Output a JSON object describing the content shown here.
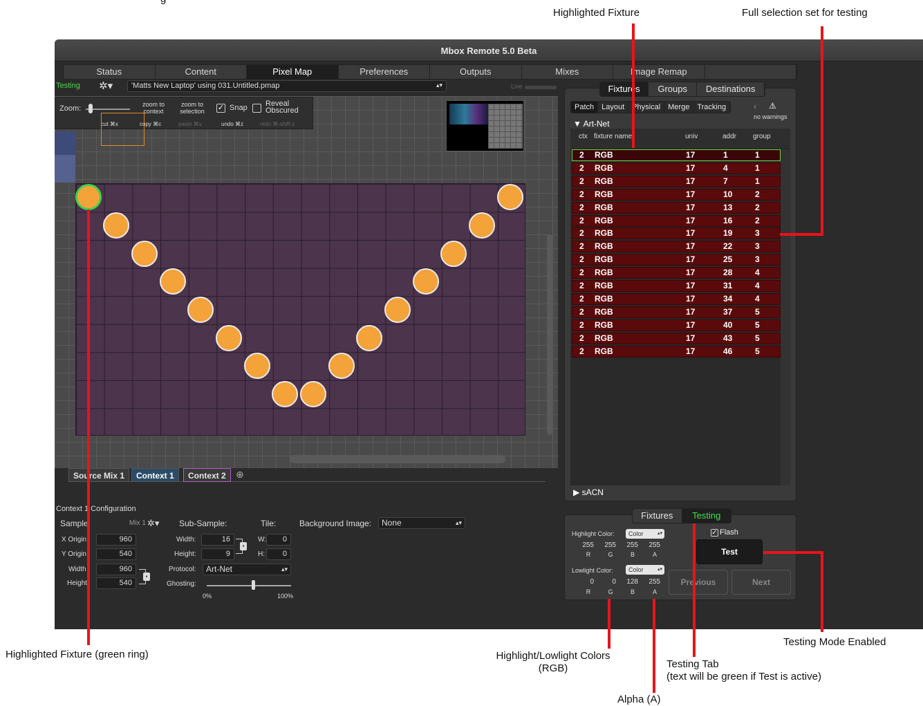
{
  "window": {
    "title": "Mbox Remote 5.0 Beta"
  },
  "tabs": [
    "Status",
    "Content",
    "Pixel Map",
    "Preferences",
    "Outputs",
    "Mixes",
    "Image Remap",
    ""
  ],
  "toolbar": {
    "testing_label": "Testing",
    "file": "'Matts New Laptop' using 031.Untitled.pmap",
    "live_label": "Live"
  },
  "zoom_panel": {
    "zoom_label": "Zoom:",
    "zoom_to_context": "zoom to context",
    "zoom_to_selection": "zoom to selection",
    "snap_label": "Snap",
    "snap_checked": true,
    "reveal_label": "Reveal Obscured",
    "reveal_checked": false,
    "cut": "cut ⌘x",
    "copy": "copy ⌘c",
    "paste": "paste ⌘v",
    "undo": "undo ⌘z",
    "redo": "redo ⌘-shift-z"
  },
  "context_tabs": [
    "Source Mix 1",
    "Context 1",
    "Context 2"
  ],
  "config": {
    "header": "Context 1 Configuration",
    "sample_label": "Sample",
    "mix_label": "Mix 1",
    "x_origin_label": "X Origin",
    "x_origin": "960",
    "y_origin_label": "Y Origin",
    "y_origin": "540",
    "width_label": "Width",
    "width": "960",
    "height_label": "Height",
    "height": "540",
    "subsample_label": "Sub-Sample:",
    "ss_width_label": "Width:",
    "ss_width": "16",
    "ss_height_label": "Height:",
    "ss_height": "9",
    "tile_label": "Tile:",
    "tile_w_label": "W:",
    "tile_w": "0",
    "tile_h_label": "H:",
    "tile_h": "0",
    "protocol_label": "Protocol:",
    "protocol": "Art-Net",
    "ghosting_label": "Ghosting:",
    "ghosting_min": "0%",
    "ghosting_max": "100%",
    "ghosting_value": 0.55,
    "bg_image_label": "Background Image:",
    "bg_image": "None"
  },
  "right_panel": {
    "tabs": [
      "Fixtures",
      "Groups",
      "Destinations"
    ],
    "subtabs": [
      "Patch",
      "Layout",
      "Physical",
      "Merge",
      "Tracking"
    ],
    "warnings": "no warnings",
    "section_artnet": "Art-Net",
    "section_sacn": "sACN",
    "columns": [
      "ctx",
      "fixture name",
      "univ",
      "addr",
      "group"
    ],
    "rows": [
      [
        "2",
        "RGB",
        "17",
        "1",
        "1"
      ],
      [
        "2",
        "RGB",
        "17",
        "4",
        "1"
      ],
      [
        "2",
        "RGB",
        "17",
        "7",
        "1"
      ],
      [
        "2",
        "RGB",
        "17",
        "10",
        "2"
      ],
      [
        "2",
        "RGB",
        "17",
        "13",
        "2"
      ],
      [
        "2",
        "RGB",
        "17",
        "16",
        "2"
      ],
      [
        "2",
        "RGB",
        "17",
        "19",
        "3"
      ],
      [
        "2",
        "RGB",
        "17",
        "22",
        "3"
      ],
      [
        "2",
        "RGB",
        "17",
        "25",
        "3"
      ],
      [
        "2",
        "RGB",
        "17",
        "28",
        "4"
      ],
      [
        "2",
        "RGB",
        "17",
        "31",
        "4"
      ],
      [
        "2",
        "RGB",
        "17",
        "34",
        "4"
      ],
      [
        "2",
        "RGB",
        "17",
        "37",
        "5"
      ],
      [
        "2",
        "RGB",
        "17",
        "40",
        "5"
      ],
      [
        "2",
        "RGB",
        "17",
        "43",
        "5"
      ],
      [
        "2",
        "RGB",
        "17",
        "46",
        "5"
      ]
    ]
  },
  "test_panel": {
    "tabs": [
      "Fixtures",
      "Testing"
    ],
    "highlight_label": "Highlight Color:",
    "highlight_mode": "Color",
    "highlight_values": [
      "255",
      "255",
      "255",
      "255"
    ],
    "lowlight_label": "Lowlight Color:",
    "lowlight_mode": "Color",
    "lowlight_values": [
      "0",
      "0",
      "128",
      "255"
    ],
    "channels": [
      "R",
      "G",
      "B",
      "A"
    ],
    "flash_label": "Flash",
    "flash_checked": true,
    "test_button": "Test",
    "previous_button": "Previous",
    "next_button": "Next"
  },
  "annotations": {
    "top_caption": "g",
    "highlighted_fixture": "Highlighted Fixture",
    "full_selection": "Full selection set for testing",
    "green_ring": "Highlighted Fixture (green ring)",
    "hl_colors_1": "Highlight/Lowlight Colors",
    "hl_colors_2": "(RGB)",
    "testing_tab_1": "Testing Tab",
    "testing_tab_2": "(text will be green if Test is active)",
    "alpha": "Alpha (A)",
    "testing_mode": "Testing Mode Enabled"
  },
  "colors": {
    "accent_green": "#3fe04a",
    "callout_red": "#e8141a",
    "fixture_orange": "#f4a23a",
    "row_red": "#5b0a0b",
    "grid_purple": "#4b344c"
  }
}
